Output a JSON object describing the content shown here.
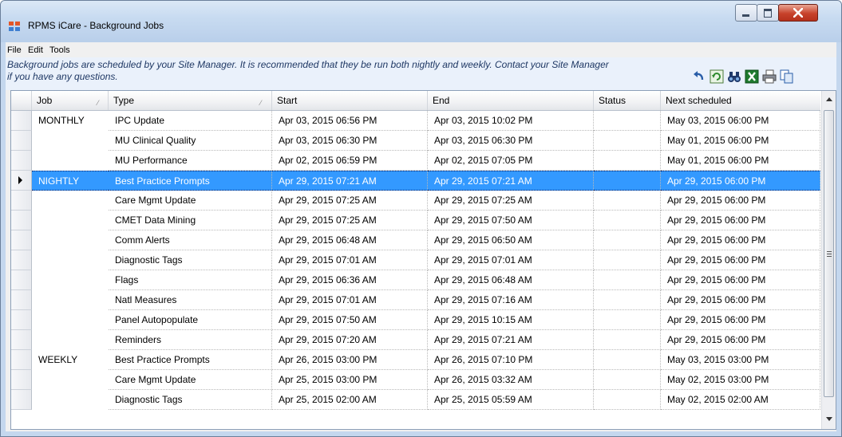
{
  "window": {
    "title": "RPMS iCare - Background Jobs"
  },
  "menu": {
    "file": "File",
    "edit": "Edit",
    "tools": "Tools"
  },
  "info": {
    "text": "Background jobs are scheduled by your Site Manager.  It is recommended that they be run both nightly and weekly.  Contact your Site Manager if you have any questions."
  },
  "toolbar_icons": [
    "undo-icon",
    "refresh-icon",
    "find-icon",
    "excel-export-icon",
    "print-icon",
    "copy-icon"
  ],
  "grid": {
    "columns": {
      "job": "Job",
      "type": "Type",
      "start": "Start",
      "end": "End",
      "status": "Status",
      "next": "Next scheduled"
    },
    "selected_row": 3,
    "rows": [
      {
        "job": "MONTHLY",
        "type": "IPC Update",
        "start": "Apr 03, 2015 06:56 PM",
        "end": "Apr 03, 2015 10:02 PM",
        "status": "",
        "next": "May 03, 2015 06:00 PM"
      },
      {
        "job": "",
        "type": "MU Clinical Quality",
        "start": "Apr 03, 2015 06:30 PM",
        "end": "Apr 03, 2015 06:30 PM",
        "status": "",
        "next": "May 01, 2015 06:00 PM"
      },
      {
        "job": "",
        "type": "MU Performance",
        "start": "Apr 02, 2015 06:59 PM",
        "end": "Apr 02, 2015 07:05 PM",
        "status": "",
        "next": "May 01, 2015 06:00 PM"
      },
      {
        "job": "NIGHTLY",
        "type": "Best Practice Prompts",
        "start": "Apr 29, 2015 07:21 AM",
        "end": "Apr 29, 2015 07:21 AM",
        "status": "",
        "next": "Apr 29, 2015 06:00 PM"
      },
      {
        "job": "",
        "type": "Care Mgmt Update",
        "start": "Apr 29, 2015 07:25 AM",
        "end": "Apr 29, 2015 07:25 AM",
        "status": "",
        "next": "Apr 29, 2015 06:00 PM"
      },
      {
        "job": "",
        "type": "CMET Data Mining",
        "start": "Apr 29, 2015 07:25 AM",
        "end": "Apr 29, 2015 07:50 AM",
        "status": "",
        "next": "Apr 29, 2015 06:00 PM"
      },
      {
        "job": "",
        "type": "Comm Alerts",
        "start": "Apr 29, 2015 06:48 AM",
        "end": "Apr 29, 2015 06:50 AM",
        "status": "",
        "next": "Apr 29, 2015 06:00 PM"
      },
      {
        "job": "",
        "type": "Diagnostic Tags",
        "start": "Apr 29, 2015 07:01 AM",
        "end": "Apr 29, 2015 07:01 AM",
        "status": "",
        "next": "Apr 29, 2015 06:00 PM"
      },
      {
        "job": "",
        "type": "Flags",
        "start": "Apr 29, 2015 06:36 AM",
        "end": "Apr 29, 2015 06:48 AM",
        "status": "",
        "next": "Apr 29, 2015 06:00 PM"
      },
      {
        "job": "",
        "type": "Natl Measures",
        "start": "Apr 29, 2015 07:01 AM",
        "end": "Apr 29, 2015 07:16 AM",
        "status": "",
        "next": "Apr 29, 2015 06:00 PM"
      },
      {
        "job": "",
        "type": "Panel Autopopulate",
        "start": "Apr 29, 2015 07:50 AM",
        "end": "Apr 29, 2015 10:15 AM",
        "status": "",
        "next": "Apr 29, 2015 06:00 PM"
      },
      {
        "job": "",
        "type": "Reminders",
        "start": "Apr 29, 2015 07:20 AM",
        "end": "Apr 29, 2015 07:21 AM",
        "status": "",
        "next": "Apr 29, 2015 06:00 PM"
      },
      {
        "job": "WEEKLY",
        "type": "Best Practice Prompts",
        "start": "Apr 26, 2015 03:00 PM",
        "end": "Apr 26, 2015 07:10 PM",
        "status": "",
        "next": "May 03, 2015 03:00 PM"
      },
      {
        "job": "",
        "type": "Care Mgmt Update",
        "start": "Apr 25, 2015 03:00 PM",
        "end": "Apr 26, 2015 03:32 AM",
        "status": "",
        "next": "May 02, 2015 03:00 PM"
      },
      {
        "job": "",
        "type": "Diagnostic Tags",
        "start": "Apr 25, 2015 02:00 AM",
        "end": "Apr 25, 2015 05:59 AM",
        "status": "",
        "next": "May 02, 2015 02:00 AM"
      }
    ]
  }
}
